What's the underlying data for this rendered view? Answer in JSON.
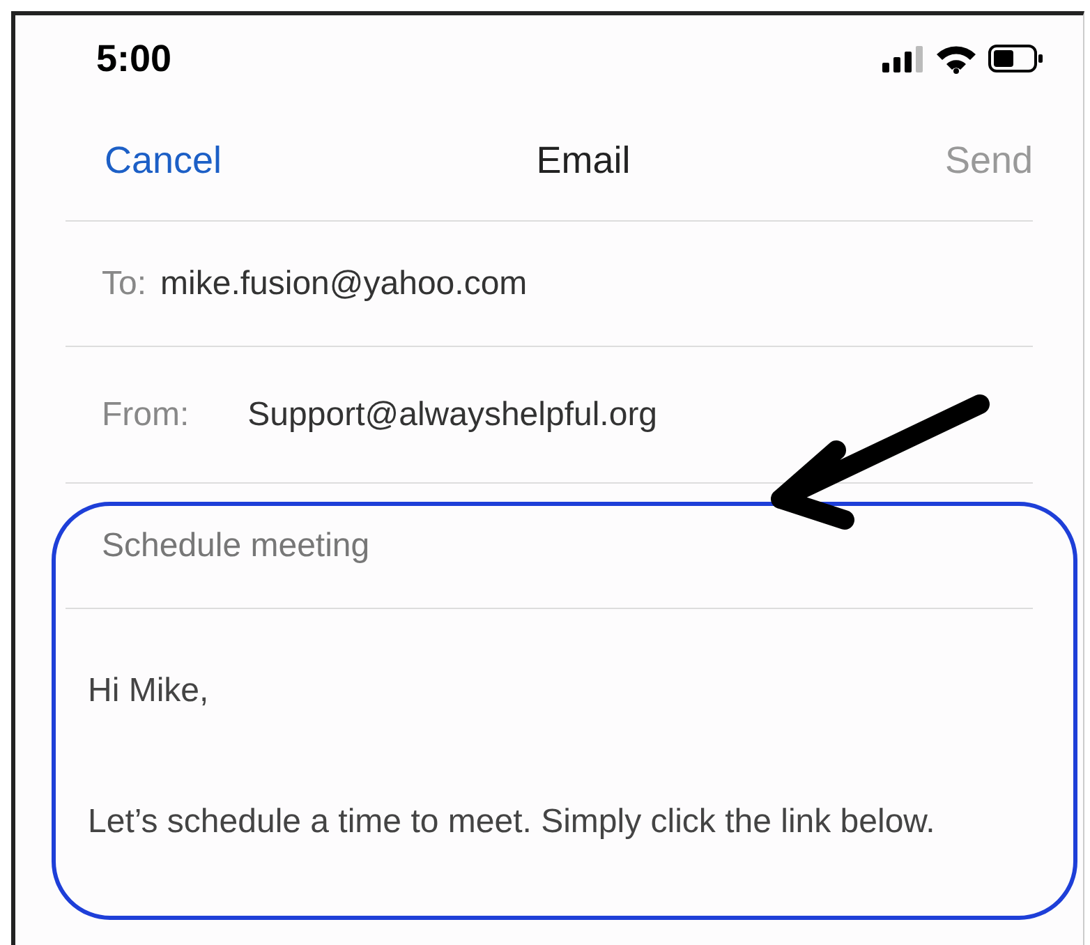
{
  "status_bar": {
    "time": "5:00"
  },
  "nav": {
    "cancel": "Cancel",
    "title": "Email",
    "send": {
      "label": "Send",
      "disabled": true
    }
  },
  "to": {
    "label": "To:",
    "value": "mike.fusion@yahoo.com"
  },
  "from": {
    "label": "From:",
    "value": "Support@alwayshelpful.org"
  },
  "subject": "Schedule meeting",
  "body": [
    "Hi Mike,",
    "Let’s schedule a time to meet. Simply click the link below."
  ]
}
